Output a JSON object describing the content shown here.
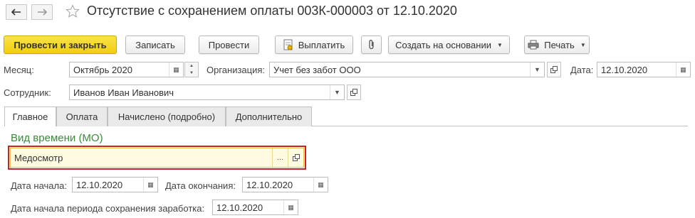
{
  "window": {
    "title": "Отсутствие с сохранением оплаты 003К-000003 от 12.10.2020"
  },
  "toolbar": {
    "post_close": "Провести и закрыть",
    "save": "Записать",
    "post": "Провести",
    "pay": "Выплатить",
    "create_based": "Создать на основании",
    "print": "Печать"
  },
  "form": {
    "month_label": "Месяц:",
    "month_value": "Октябрь 2020",
    "org_label": "Организация:",
    "org_value": "Учет без забот ООО",
    "date_label": "Дата:",
    "date_value": "12.10.2020",
    "employee_label": "Сотрудник:",
    "employee_value": "Иванов Иван Иванович"
  },
  "tabs": [
    "Главное",
    "Оплата",
    "Начислено (подробно)",
    "Дополнительно"
  ],
  "main": {
    "section_title": "Вид времени (МО)",
    "time_type_value": "Медосмотр",
    "start_label": "Дата начала:",
    "start_value": "12.10.2020",
    "end_label": "Дата окончания:",
    "end_value": "12.10.2020",
    "period_label": "Дата начала периода сохранения заработка:",
    "period_value": "12.10.2020"
  },
  "colors": {
    "primary_button": "#f2ce0d",
    "section_title": "#3a8a3a",
    "highlight_border": "#cc2222",
    "active_field_bg": "#fffbe1"
  },
  "icons": [
    "back-arrow-icon",
    "forward-arrow-icon",
    "star-icon",
    "pay-icon",
    "attach-icon",
    "print-icon",
    "calendar-icon",
    "open-icon",
    "dropdown-icon",
    "ellipsis-icon"
  ]
}
